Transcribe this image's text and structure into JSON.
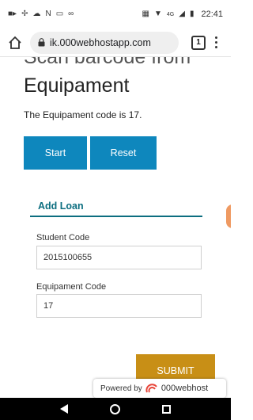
{
  "status_bar": {
    "time": "22:41",
    "network": "4G"
  },
  "browser": {
    "url": "ik.000webhostapp.com",
    "tab_count": "1"
  },
  "page": {
    "heading_partial": "Scan barcode from",
    "heading": "Equipament",
    "code_message": "The Equipament code is 17.",
    "start_label": "Start",
    "reset_label": "Reset",
    "form": {
      "title": "Add Loan",
      "student_label": "Student Code",
      "student_value": "2015100655",
      "equipment_label": "Equipament Code",
      "equipment_value": "17",
      "submit_label": "SUBMIT"
    }
  },
  "powered_by": {
    "prefix": "Powered by",
    "brand": "000webhost"
  },
  "colors": {
    "primary_button": "#0e87bd",
    "submit_button": "#c88f16",
    "section_accent": "#0c6e80"
  }
}
